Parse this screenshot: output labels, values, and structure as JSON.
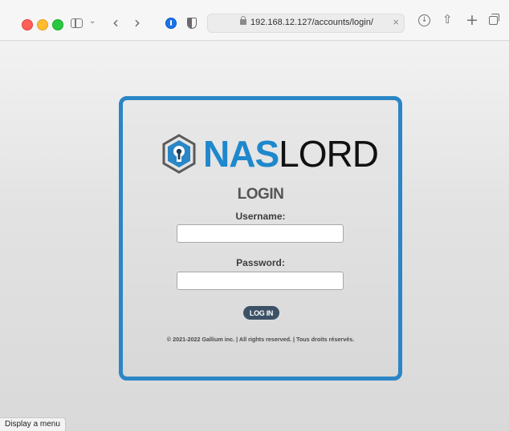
{
  "browser": {
    "url": "192.168.12.127/accounts/login/",
    "clear_glyph": "×",
    "back_glyph": "‹",
    "forward_glyph": "›",
    "chevron_glyph": "⌄",
    "download_glyph": "↓",
    "share_glyph": "⇧",
    "new_tab_glyph": "+"
  },
  "login": {
    "logo_bold": "NAS",
    "logo_light": "LORD",
    "heading": "LOGIN",
    "username_label": "Username:",
    "username_value": "",
    "password_label": "Password:",
    "password_value": "",
    "button_label": "LOG IN",
    "copyright": "© 2021-2022 Gallium inc. | All rights reserved. | Tous droits réservés."
  },
  "status_bar": {
    "text": "Display a menu"
  },
  "colors": {
    "brand_blue": "#2a86c5",
    "button_dark": "#3c5166"
  }
}
